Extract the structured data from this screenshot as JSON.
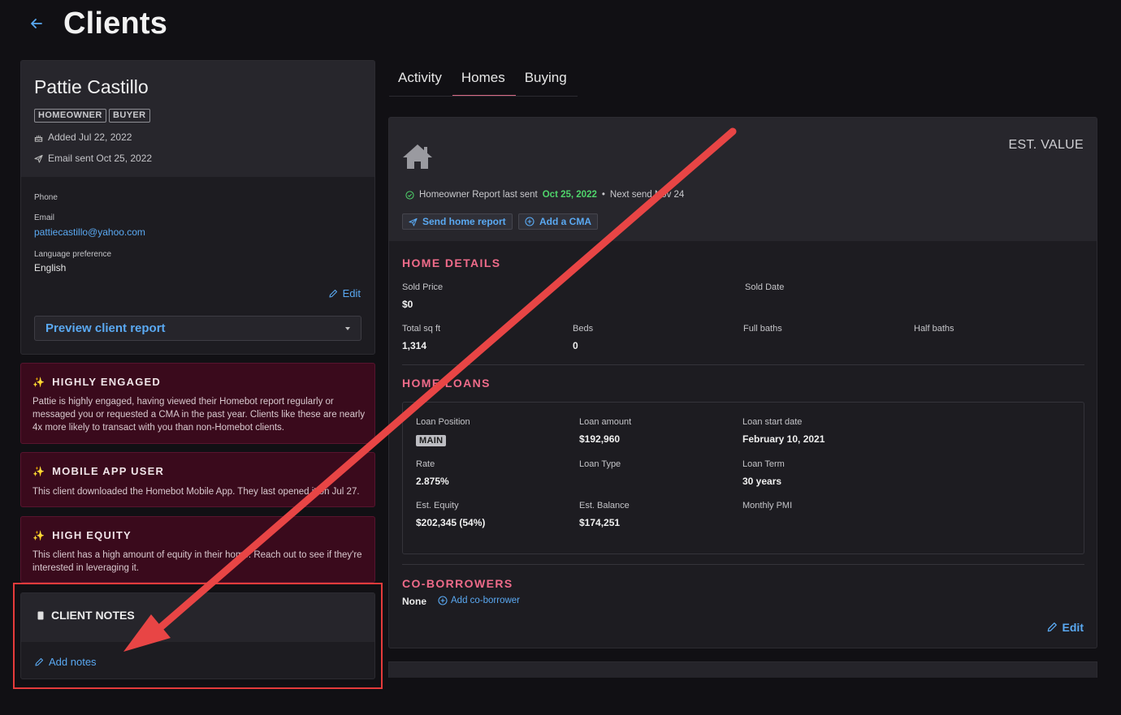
{
  "header": {
    "title": "Clients"
  },
  "client": {
    "name": "Pattie Castillo",
    "tags": [
      "HOMEOWNER",
      "BUYER"
    ],
    "added": "Added Jul 22, 2022",
    "email_sent": "Email sent Oct 25, 2022",
    "phone_label": "Phone",
    "email_label": "Email",
    "email": "pattiecastillo@yahoo.com",
    "language_label": "Language preference",
    "language": "English",
    "edit_label": "Edit",
    "preview_label": "Preview client report"
  },
  "insights": [
    {
      "title": "HIGHLY ENGAGED",
      "body": "Pattie is highly engaged, having viewed their Homebot report regularly or messaged you or requested a CMA in the past year. Clients like these are nearly 4x more likely to transact with you than non-Homebot clients."
    },
    {
      "title": "MOBILE APP USER",
      "body": "This client downloaded the Homebot Mobile App. They last opened it on Jul 27."
    },
    {
      "title": "HIGH EQUITY",
      "body": "This client has a high amount of equity in their home. Reach out to see if they're interested in leveraging it."
    }
  ],
  "notes": {
    "title": "CLIENT NOTES",
    "add_label": "Add notes"
  },
  "tabs": [
    "Activity",
    "Homes",
    "Buying"
  ],
  "active_tab": "Homes",
  "home": {
    "est_value_label": "EST. VALUE",
    "report_prefix": "Homeowner Report last sent",
    "report_date": "Oct 25, 2022",
    "separator": "•",
    "next_send": "Next send Nov 24",
    "send_report_label": "Send home report",
    "add_cma_label": "Add a CMA",
    "details_title": "HOME DETAILS",
    "sold_price_label": "Sold Price",
    "sold_price": "$0",
    "sold_date_label": "Sold Date",
    "total_sqft_label": "Total sq ft",
    "total_sqft": "1,314",
    "beds_label": "Beds",
    "beds": "0",
    "full_baths_label": "Full baths",
    "half_baths_label": "Half baths",
    "loans_title": "HOME LOANS",
    "loan_position_label": "Loan Position",
    "loan_position": "MAIN",
    "loan_amount_label": "Loan amount",
    "loan_amount": "$192,960",
    "loan_start_label": "Loan start date",
    "loan_start": "February 10, 2021",
    "rate_label": "Rate",
    "rate": "2.875%",
    "loan_type_label": "Loan Type",
    "loan_term_label": "Loan Term",
    "loan_term": "30 years",
    "equity_label": "Est. Equity",
    "equity": "$202,345 (54%)",
    "balance_label": "Est. Balance",
    "balance": "$174,251",
    "pmi_label": "Monthly PMI",
    "coborrowers_title": "CO-BORROWERS",
    "coborrowers_value": "None",
    "add_coborrower_label": "Add co-borrower",
    "edit_label": "Edit"
  },
  "colors": {
    "accent_blue": "#5aa9f2",
    "section_pink": "#ef6b8a",
    "insight_bg": "#3a0a1c",
    "annotation_red": "#e53b3b",
    "report_green": "#4fd46b"
  }
}
